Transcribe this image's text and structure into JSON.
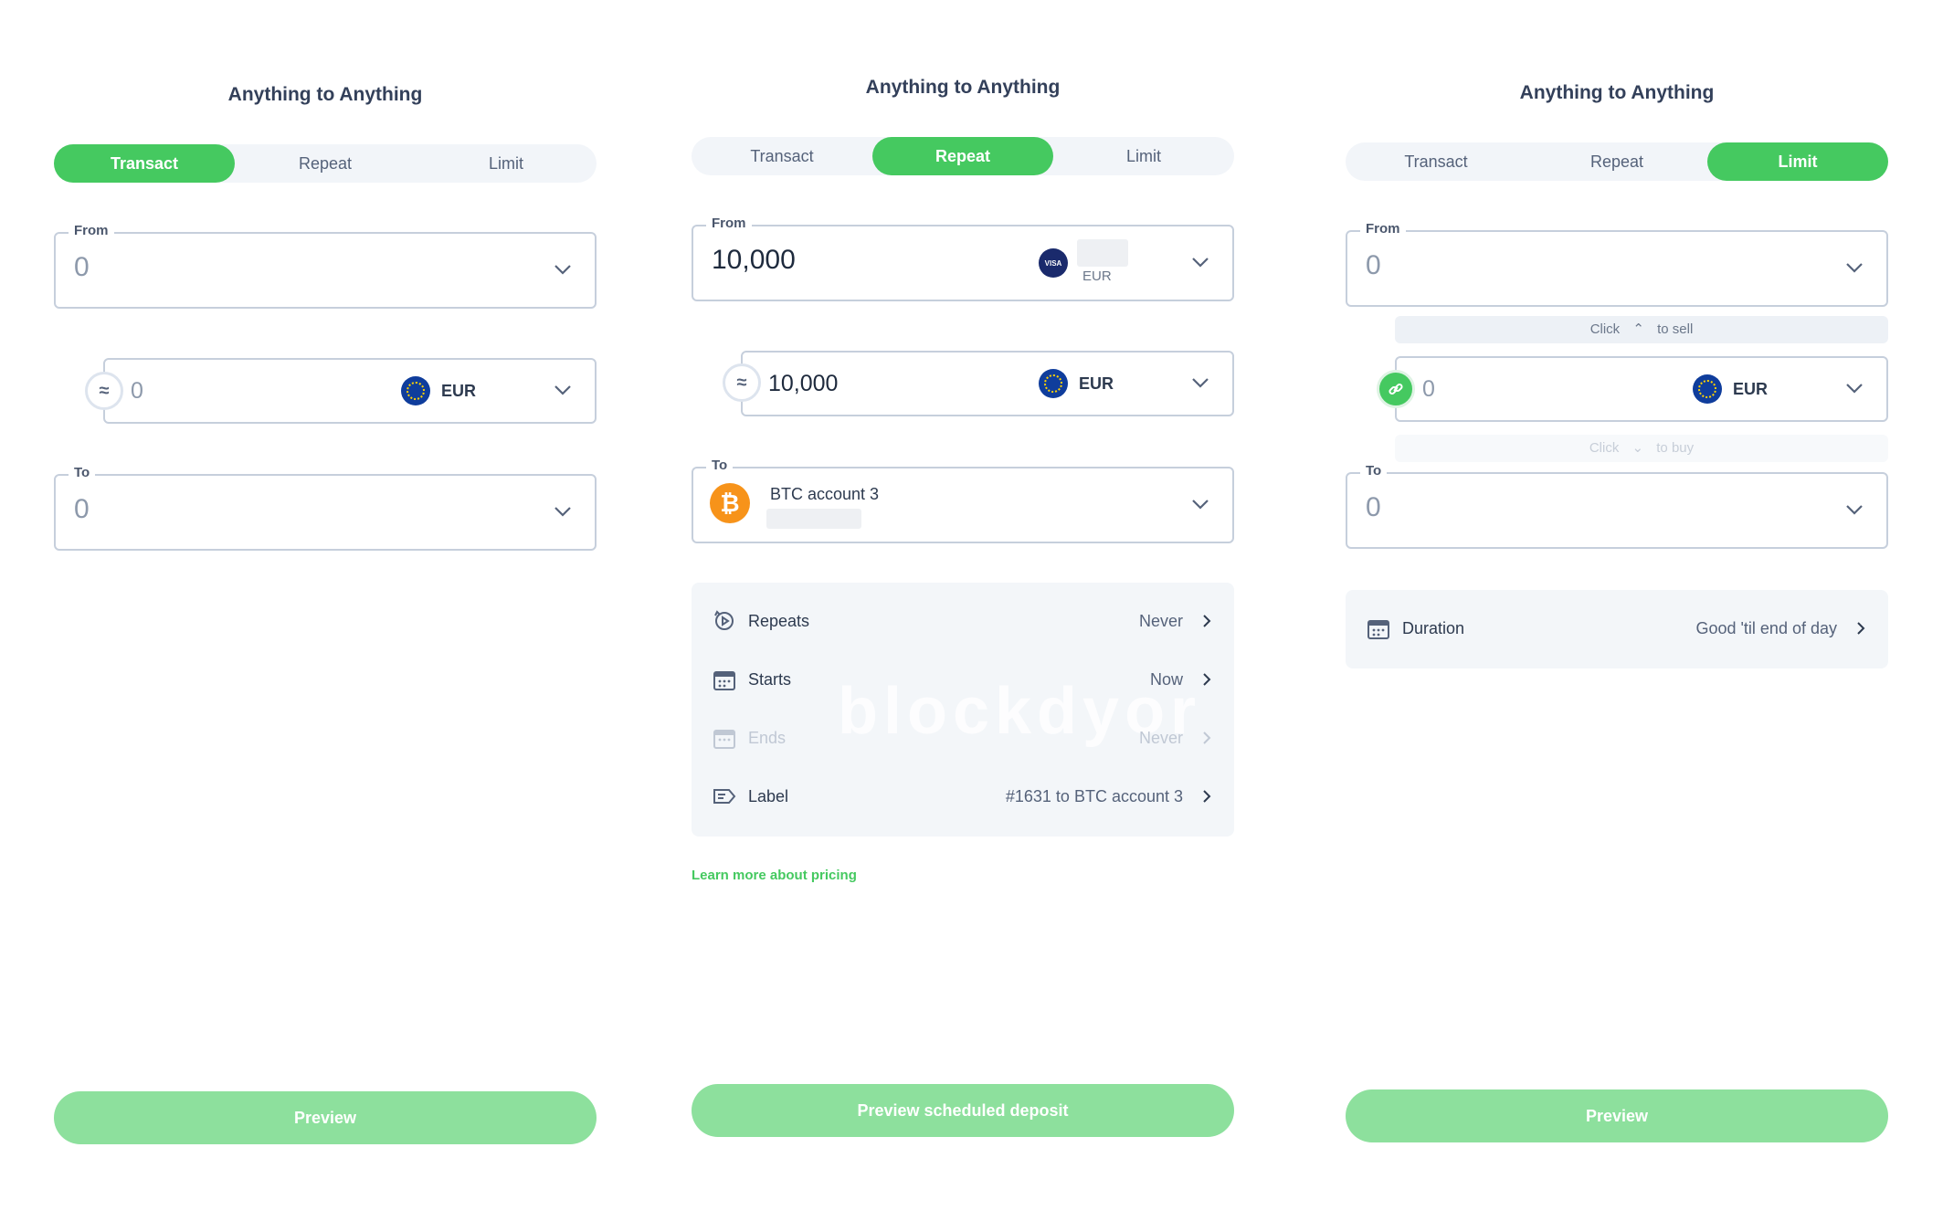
{
  "panels": [
    {
      "title": "Anything to Anything",
      "tabs": [
        "Transact",
        "Repeat",
        "Limit"
      ],
      "active_tab": "Transact",
      "from": {
        "legend": "From",
        "value": "0"
      },
      "middle": {
        "value": "0",
        "currency": "EUR"
      },
      "to": {
        "legend": "To",
        "value": "0"
      },
      "button": "Preview"
    },
    {
      "title": "Anything to Anything",
      "tabs": [
        "Transact",
        "Repeat",
        "Limit"
      ],
      "active_tab": "Repeat",
      "from": {
        "legend": "From",
        "value": "10,000",
        "card_brand": "VISA",
        "currency": "EUR"
      },
      "middle": {
        "value": "10,000",
        "currency": "EUR"
      },
      "to": {
        "legend": "To",
        "account": "BTC account 3",
        "coin_symbol": "₿"
      },
      "schedule": [
        {
          "label": "Repeats",
          "value": "Never",
          "icon": "repeat-icon",
          "disabled": false
        },
        {
          "label": "Starts",
          "value": "Now",
          "icon": "calendar-icon",
          "disabled": false
        },
        {
          "label": "Ends",
          "value": "Never",
          "icon": "calendar-icon",
          "disabled": true
        },
        {
          "label": "Label",
          "value": "#1631 to BTC account 3",
          "icon": "label-icon",
          "disabled": false
        }
      ],
      "watermark": "blockdyor",
      "pricing_link": "Learn more about pricing",
      "button": "Preview scheduled deposit"
    },
    {
      "title": "Anything to Anything",
      "tabs": [
        "Transact",
        "Repeat",
        "Limit"
      ],
      "active_tab": "Limit",
      "from": {
        "legend": "From",
        "value": "0"
      },
      "hint_sell": {
        "prefix": "Click",
        "suffix": "to sell"
      },
      "middle": {
        "value": "0",
        "currency": "EUR"
      },
      "hint_buy": {
        "prefix": "Click",
        "suffix": "to buy"
      },
      "to": {
        "legend": "To",
        "value": "0"
      },
      "duration": {
        "label": "Duration",
        "value": "Good 'til end of day"
      },
      "button": "Preview"
    }
  ],
  "colors": {
    "accent": "#45c960",
    "button_disabled": "#8de09d",
    "border": "#c6cfdc",
    "card_bg": "#f3f6f9",
    "bitcoin": "#f7931a",
    "eu_blue": "#0f3d9c"
  }
}
